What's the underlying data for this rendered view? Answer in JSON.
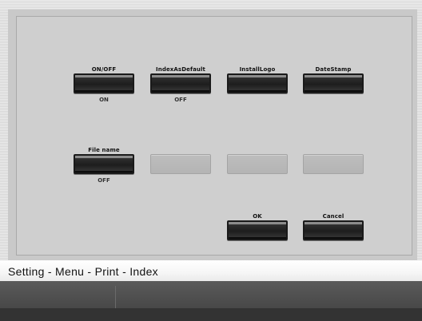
{
  "buttons_row1": [
    {
      "label": "ON/OFF",
      "status": "ON"
    },
    {
      "label": "IndexAsDefault",
      "status": "OFF"
    },
    {
      "label": "InstallLogo",
      "status": ""
    },
    {
      "label": "DateStamp",
      "status": ""
    }
  ],
  "buttons_row2": [
    {
      "label": "File name",
      "status": "OFF"
    }
  ],
  "dialog": {
    "ok_label": "OK",
    "cancel_label": "Cancel"
  },
  "breadcrumb": {
    "text": "Setting - Menu - Print - Index"
  },
  "colors": {
    "panel": "#cfcfcf",
    "button_dark": "#1d1d1d",
    "button_disabled": "#b8b8b8",
    "title_bar": "#f6f6f6",
    "bottom_bar": "#484848"
  }
}
